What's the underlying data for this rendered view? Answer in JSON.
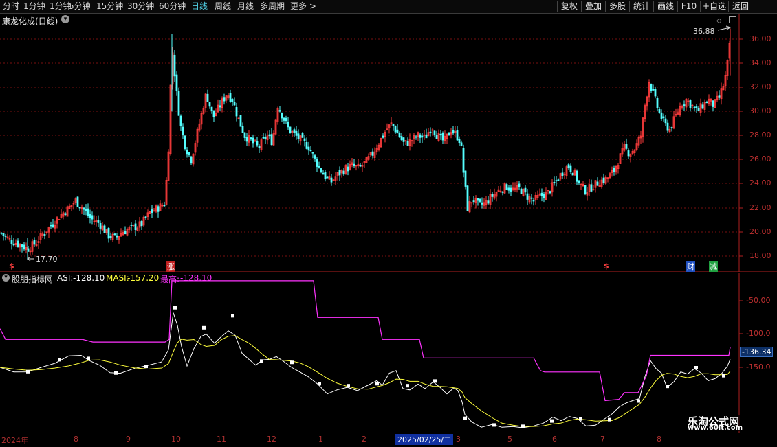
{
  "toolbar": {
    "periods": [
      "分时",
      "1分钟",
      "5分钟",
      "15分钟",
      "30分钟",
      "60分钟",
      "日线",
      "周线",
      "月线",
      "多周期",
      "更多"
    ],
    "active_period": "日线",
    "more_icon": "chevron-right-icon",
    "right_buttons": [
      "复权",
      "叠加",
      "多股",
      "统计",
      "画线",
      "F10",
      "+自选",
      "返回"
    ]
  },
  "stock": {
    "title": "康龙化成(日线)",
    "high_label": "36.88",
    "low_label": "17.70",
    "price_axis": [
      "36.00",
      "34.00",
      "32.00",
      "30.00",
      "28.00",
      "26.00",
      "24.00",
      "22.00",
      "20.00",
      "18.00"
    ],
    "markers": {
      "s1": "$",
      "zhang": "涨",
      "s2": "$",
      "cai": "财",
      "jian": "减"
    }
  },
  "indicator": {
    "name": "股朋指标网",
    "asi_label": "ASI:",
    "asi_value": "-128.10",
    "masi_label": "MASI:",
    "masi_value": "-157.20",
    "max_label": "最高:",
    "max_value": "-128.10",
    "axis": [
      "-50.00",
      "-100.0",
      "-150.0"
    ],
    "current_tag": "-136.34"
  },
  "time_axis": {
    "labels": [
      "2024年",
      "8",
      "9",
      "10",
      "11",
      "12",
      "1",
      "2",
      "3",
      "4",
      "5",
      "6",
      "7",
      "8"
    ],
    "cursor_date": "2025/02/25/二"
  },
  "watermark": {
    "brand": "乐淘公式网",
    "url": "www.60lt.com"
  },
  "colors": {
    "up": "#ff3d3d",
    "down": "#54ffff",
    "asi": "#ffffff",
    "masi": "#ffff3c",
    "max": "#ff33ff",
    "grid": "#7a1010",
    "axis": "#b02020"
  }
}
